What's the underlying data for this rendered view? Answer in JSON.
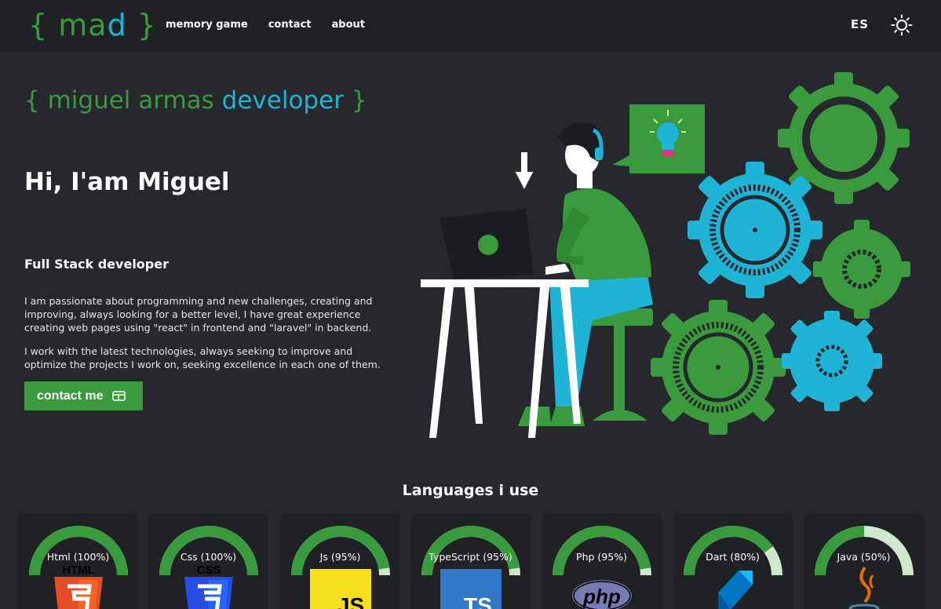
{
  "nav": {
    "logo": {
      "open": "{",
      "word": "ma",
      "d": "d",
      "close": "}"
    },
    "links": [
      "memory game",
      "contact",
      "about"
    ],
    "lang": "ES",
    "theme_icon": "sun-icon"
  },
  "hero": {
    "brand": {
      "open": "{",
      "name": "miguel armas",
      "role": "developer",
      "close": "}"
    },
    "greeting": "Hi, I'am Miguel",
    "role": "Full Stack developer",
    "paragraph1": "I am passionate about programming and new challenges, creating and improving, always looking for a better level, I have great experience creating web pages using \"react\" in frontend and \"laravel\" in backend.",
    "paragraph2": "I work with the latest technologies, always seeking to improve and optimize the projects I work on, seeking excellence in each one of them.",
    "contact_button": "contact me"
  },
  "languages": {
    "title": "Languages i use",
    "items": [
      {
        "label": "Html (100%)",
        "percent": 100,
        "logo": "html5-logo",
        "logo_text": "HTML"
      },
      {
        "label": "Css (100%)",
        "percent": 100,
        "logo": "css3-logo",
        "logo_text": "CSS"
      },
      {
        "label": "Js (95%)",
        "percent": 95,
        "logo": "js-logo",
        "logo_text": "JS"
      },
      {
        "label": "TypeScript (95%)",
        "percent": 95,
        "logo": "typescript-logo",
        "logo_text": "TS"
      },
      {
        "label": "Php (95%)",
        "percent": 95,
        "logo": "php-logo",
        "logo_text": "php"
      },
      {
        "label": "Dart (80%)",
        "percent": 80,
        "logo": "dart-logo",
        "logo_text": ""
      },
      {
        "label": "Java (50%)",
        "percent": 50,
        "logo": "java-logo",
        "logo_text": ""
      }
    ]
  },
  "colors": {
    "background": "#27282e",
    "navbar": "#202125",
    "green": "#3a9a3e",
    "cyan": "#1fb3d6",
    "gauge_track": "#cde8cc"
  }
}
